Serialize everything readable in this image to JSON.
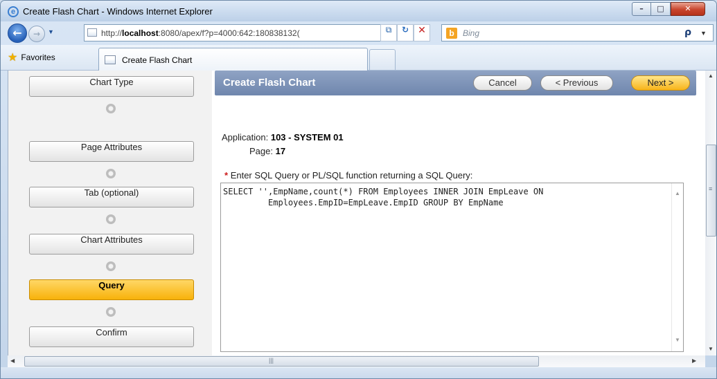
{
  "window": {
    "title": "Create Flash Chart - Windows Internet Explorer",
    "min_glyph": "–",
    "max_glyph": "□",
    "close_glyph": "✕"
  },
  "toolbar": {
    "back_glyph": "←",
    "forward_glyph": "→",
    "nav_dropdown_glyph": "▼",
    "url_prefix": "http://",
    "url_host": "localhost",
    "url_rest": ":8080/apex/f?p=4000:642:180838132(",
    "url_dropdown_glyph": "▼",
    "search_placeholder": "Bing",
    "search_glyph": "ρ",
    "search_dropdown_glyph": "▼"
  },
  "favorites": {
    "label": "Favorites",
    "tab_title": "Create Flash Chart"
  },
  "wizard": {
    "steps": [
      {
        "label": "Chart Type",
        "active": false
      },
      {
        "label": "Page Attributes",
        "active": false
      },
      {
        "label": "Tab (optional)",
        "active": false
      },
      {
        "label": "Chart Attributes",
        "active": false
      },
      {
        "label": "Query",
        "active": true
      },
      {
        "label": "Confirm",
        "active": false
      }
    ]
  },
  "panel": {
    "title": "Create Flash Chart",
    "cancel_label": "Cancel",
    "previous_label": "< Previous",
    "next_label": "Next >",
    "application_label": "Application:",
    "application_value": "103 - SYSTEM 01",
    "page_label": "Page:",
    "page_value": "17",
    "required_marker": "*",
    "query_label": "Enter SQL Query or PL/SQL function returning a SQL Query:",
    "query_text": "SELECT '',EmpName,count(*) FROM Employees INNER JOIN EmpLeave ON\n         Employees.EmpID=EmpLeave.EmpID GROUP BY EmpName"
  },
  "colors": {
    "active_step": "#f8b20a",
    "panel_header": "#7e93b8",
    "next_button": "#f7b41a"
  }
}
